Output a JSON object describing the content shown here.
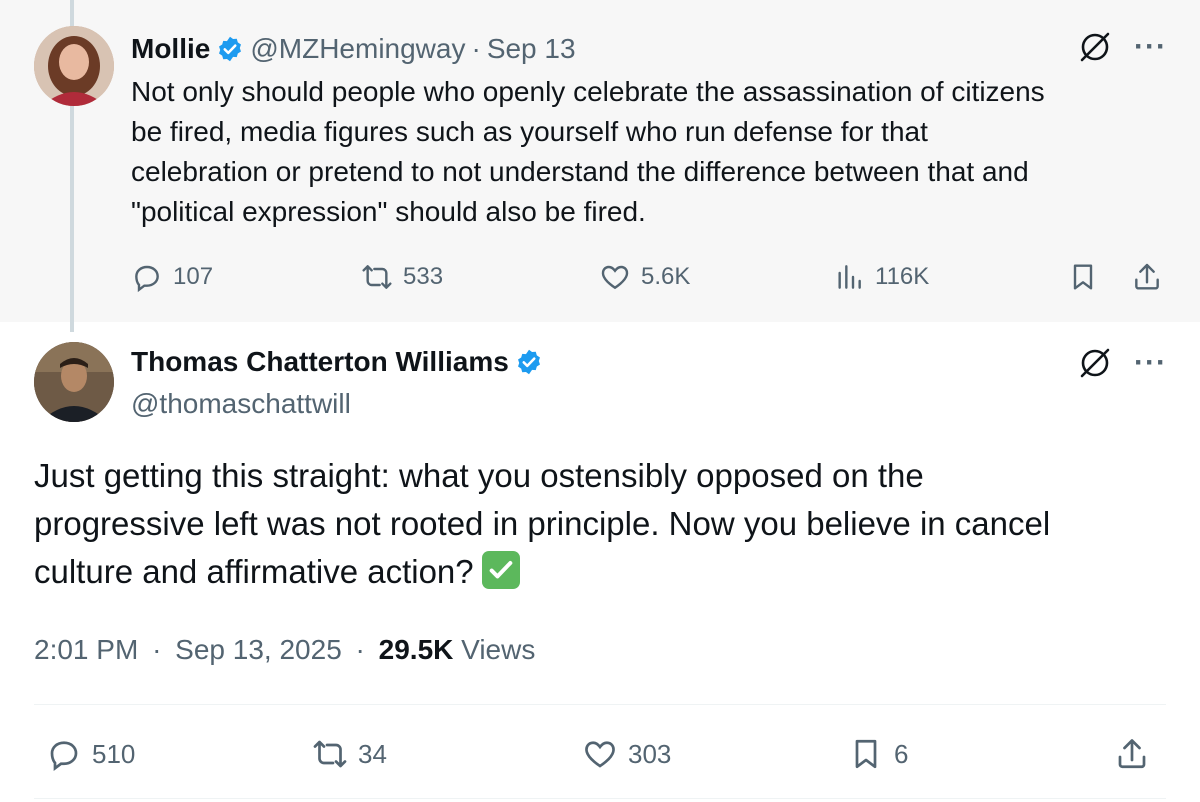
{
  "colors": {
    "accent": "#1d9bf0",
    "muted": "#536471",
    "text": "#0f1419",
    "parent_bg": "#f7f7f7"
  },
  "parent": {
    "name": "Mollie",
    "handle": "@MZHemingway",
    "separator": "·",
    "date": "Sep 13",
    "text_lines": [
      "Not only should people who openly celebrate the assassination of citizens",
      "be fired, media figures such as yourself who run defense for that",
      "celebration or pretend to not understand the difference between that and",
      "\"political expression\" should also be fired."
    ],
    "replies": "107",
    "reposts": "533",
    "likes": "5.6K",
    "views": "116K",
    "icons": [
      "grok-icon",
      "more-icon",
      "reply-icon",
      "repost-icon",
      "like-icon",
      "views-icon",
      "bookmark-icon",
      "share-icon"
    ]
  },
  "main": {
    "name": "Thomas Chatterton Williams",
    "handle": "@thomaschattwill",
    "text_lines": [
      "Just getting this straight: what you ostensibly opposed on the",
      "progressive left was not rooted in principle. Now you believe in cancel",
      "culture and affirmative action?"
    ],
    "time": "2:01 PM",
    "separator": "·",
    "date": "Sep 13, 2025",
    "views_count": "29.5K",
    "views_label": "Views",
    "replies": "510",
    "reposts": "34",
    "likes": "303",
    "bookmarks": "6"
  }
}
